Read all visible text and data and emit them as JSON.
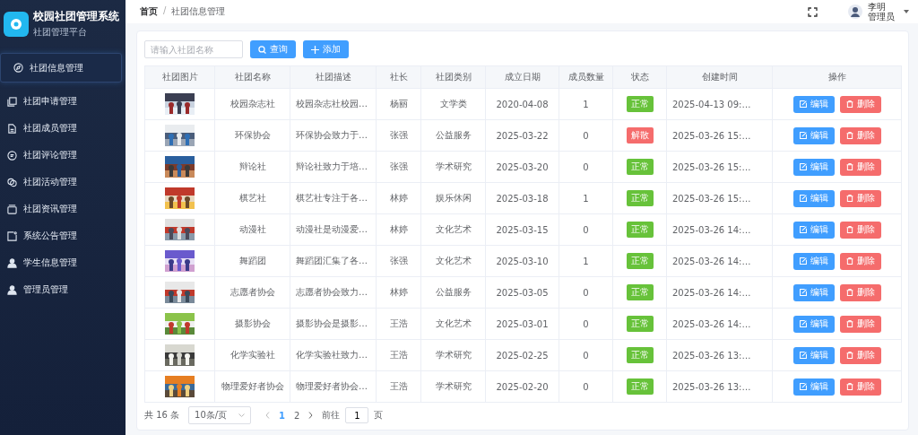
{
  "sidebar": {
    "logo_title": "校园社团管理系统",
    "logo_subtitle": "社团管理平台",
    "items": [
      {
        "label": "社团信息管理",
        "selected": true
      },
      {
        "label": "社团申请管理",
        "selected": false
      },
      {
        "label": "社团成员管理",
        "selected": false
      },
      {
        "label": "社团评论管理",
        "selected": false
      },
      {
        "label": "社团活动管理",
        "selected": false
      },
      {
        "label": "社团资讯管理",
        "selected": false
      },
      {
        "label": "系统公告管理",
        "selected": false
      },
      {
        "label": "学生信息管理",
        "selected": false
      },
      {
        "label": "管理员管理",
        "selected": false
      }
    ]
  },
  "topbar": {
    "breadcrumb": [
      "首页",
      "/",
      "社团信息管理"
    ],
    "user_name": "李明",
    "user_role": "管理员"
  },
  "toolbar": {
    "search": {
      "placeholder": "请输入社团名称"
    },
    "search_button": "查询",
    "add_button": "添加"
  },
  "table": {
    "columns": [
      "社团图片",
      "社团名称",
      "社团描述",
      "社长",
      "社团类别",
      "成立日期",
      "成员数量",
      "状态",
      "创建时间",
      "操作"
    ],
    "rows": [
      {
        "name": "校园杂志社",
        "description": "校园杂志社校园…",
        "leader": "杨丽",
        "category": "文学类",
        "founded": "2020-04-08",
        "members": "1",
        "status": {
          "text": "正常",
          "kind": "normal"
        },
        "created": "2025-04-13 09:…",
        "edit": "编辑",
        "delete": "删除"
      },
      {
        "name": "环保协会",
        "description": "环保协会致力于…",
        "leader": "张强",
        "category": "公益服务",
        "founded": "2025-03-22",
        "members": "0",
        "status": {
          "text": "解散",
          "kind": "dissolved"
        },
        "created": "2025-03-26 15:…",
        "edit": "编辑",
        "delete": "删除"
      },
      {
        "name": "辩论社",
        "description": "辩论社致力于培…",
        "leader": "张强",
        "category": "学术研究",
        "founded": "2025-03-20",
        "members": "0",
        "status": {
          "text": "正常",
          "kind": "normal"
        },
        "created": "2025-03-26 15:…",
        "edit": "编辑",
        "delete": "删除"
      },
      {
        "name": "棋艺社",
        "description": "棋艺社专注于各…",
        "leader": "林婷",
        "category": "娱乐休闲",
        "founded": "2025-03-18",
        "members": "1",
        "status": {
          "text": "正常",
          "kind": "normal"
        },
        "created": "2025-03-26 15:…",
        "edit": "编辑",
        "delete": "删除"
      },
      {
        "name": "动漫社",
        "description": "动漫社是动漫爱…",
        "leader": "林婷",
        "category": "文化艺术",
        "founded": "2025-03-15",
        "members": "0",
        "status": {
          "text": "正常",
          "kind": "normal"
        },
        "created": "2025-03-26 14:…",
        "edit": "编辑",
        "delete": "删除"
      },
      {
        "name": "舞蹈团",
        "description": "舞蹈团汇集了各…",
        "leader": "张强",
        "category": "文化艺术",
        "founded": "2025-03-10",
        "members": "1",
        "status": {
          "text": "正常",
          "kind": "normal"
        },
        "created": "2025-03-26 14:…",
        "edit": "编辑",
        "delete": "删除"
      },
      {
        "name": "志愿者协会",
        "description": "志愿者协会致力…",
        "leader": "林婷",
        "category": "公益服务",
        "founded": "2025-03-05",
        "members": "0",
        "status": {
          "text": "正常",
          "kind": "normal"
        },
        "created": "2025-03-26 14:…",
        "edit": "编辑",
        "delete": "删除"
      },
      {
        "name": "摄影协会",
        "description": "摄影协会是摄影…",
        "leader": "王浩",
        "category": "文化艺术",
        "founded": "2025-03-01",
        "members": "0",
        "status": {
          "text": "正常",
          "kind": "normal"
        },
        "created": "2025-03-26 14:…",
        "edit": "编辑",
        "delete": "删除"
      },
      {
        "name": "化学实验社",
        "description": "化学实验社致力…",
        "leader": "王浩",
        "category": "学术研究",
        "founded": "2025-02-25",
        "members": "0",
        "status": {
          "text": "正常",
          "kind": "normal"
        },
        "created": "2025-03-26 13:…",
        "edit": "编辑",
        "delete": "删除"
      },
      {
        "name": "物理爱好者协会",
        "description": "物理爱好者协会…",
        "leader": "王浩",
        "category": "学术研究",
        "founded": "2025-02-20",
        "members": "0",
        "status": {
          "text": "正常",
          "kind": "normal"
        },
        "created": "2025-03-26 13:…",
        "edit": "编辑",
        "delete": "删除"
      }
    ]
  },
  "pagination": {
    "total": "共 16 条",
    "page_size": "10条/页",
    "pages": [
      {
        "label": "1",
        "selected": true
      },
      {
        "label": "2",
        "selected": false
      }
    ],
    "goto_label": "前往",
    "goto_value": "1",
    "page_suffix": "页"
  }
}
